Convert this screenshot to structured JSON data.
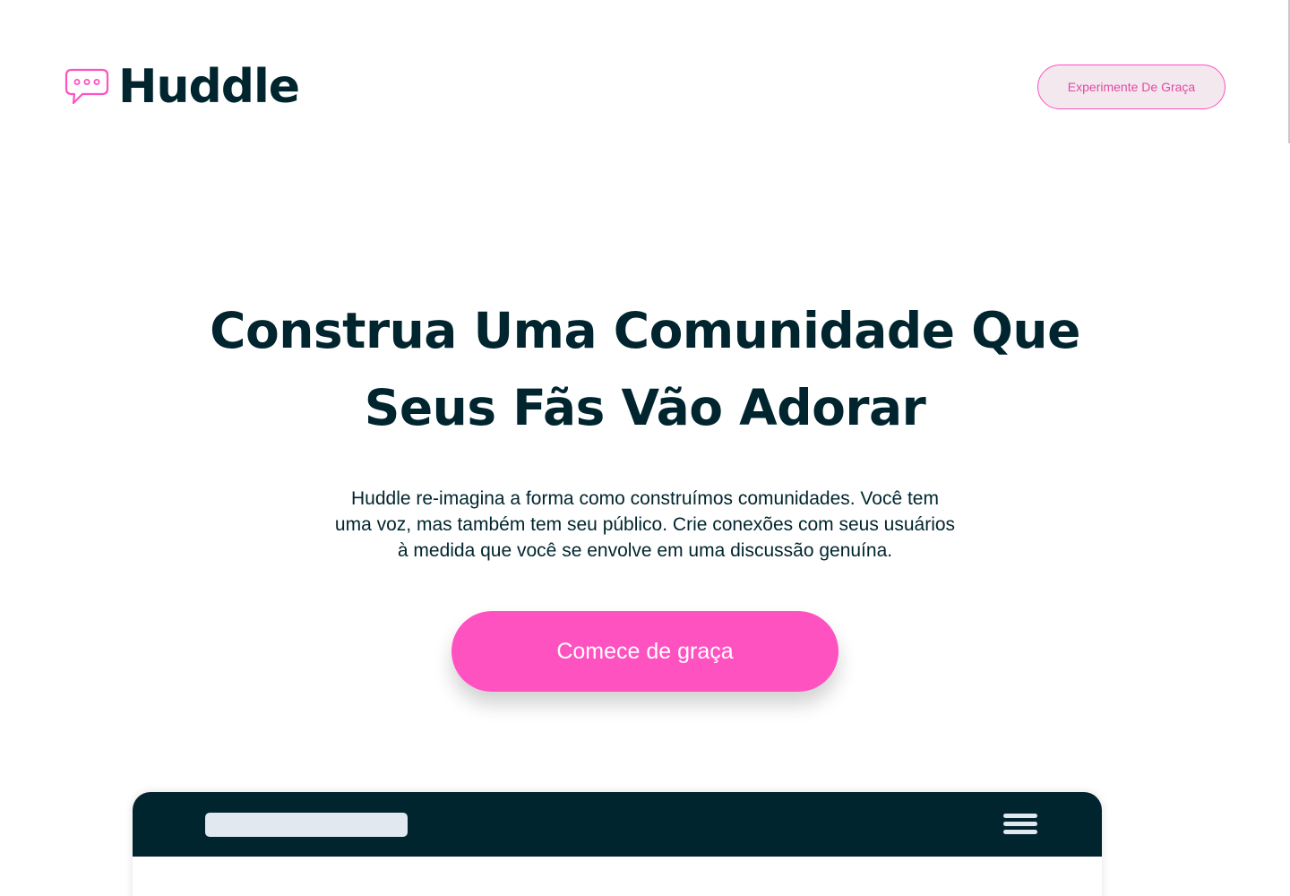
{
  "header": {
    "logo_text": "Huddle",
    "logo_icon": "chat-bubble-icon",
    "cta_label": "Experimente De Graça"
  },
  "hero": {
    "title_lines": [
      "Construa Uma Comunidade Que",
      "Seus Fãs Vão Adorar"
    ],
    "description_lines": [
      "Huddle re-imagina a forma como construímos comunidades. Você tem",
      "uma voz, mas também tem seu público. Crie conexões com seus usuários",
      "à medida que você se envolve em uma discussão genuína."
    ],
    "cta_label": "Comece de graça"
  },
  "mockup": {
    "menu_icon": "hamburger-menu-icon"
  },
  "colors": {
    "primary_dark": "#00252e",
    "accent_pink": "#ff52c1",
    "placeholder_gray": "#e2e8f0"
  }
}
